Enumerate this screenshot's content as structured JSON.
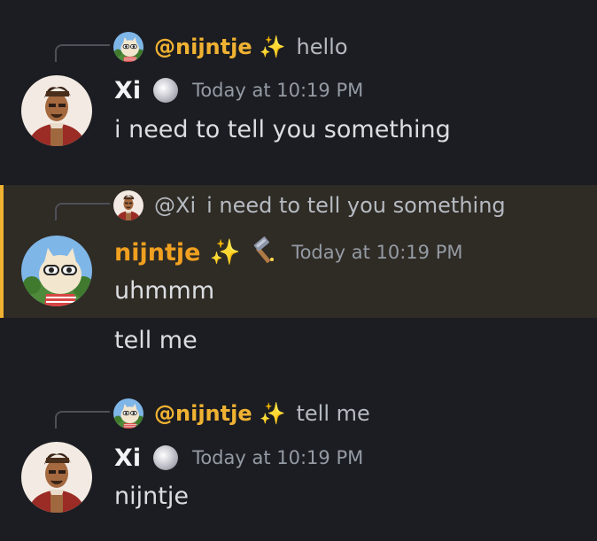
{
  "messages": [
    {
      "reply": {
        "name": "@nijntje",
        "snippet": "hello"
      },
      "author": "Xi",
      "timestamp": "Today at 10:19 PM",
      "content": "i need to tell you something"
    },
    {
      "reply": {
        "name": "@Xi",
        "snippet": "i need to tell you something"
      },
      "author": "nijntje",
      "timestamp": "Today at 10:19 PM",
      "content": "uhmmm",
      "followup": "tell me"
    },
    {
      "reply": {
        "name": "@nijntje",
        "snippet": "tell me"
      },
      "author": "Xi",
      "timestamp": "Today at 10:19 PM",
      "content": "nijntje"
    }
  ],
  "icons": {
    "sparkle": "✨",
    "hammer": "hammer-icon",
    "badge": "orb-badge-icon"
  },
  "colors": {
    "background": "#1c1d22",
    "highlight": "#2f2b25",
    "highlight_border": "#f0b232",
    "name_orange": "#f0a020",
    "timestamp": "#949ba4"
  }
}
